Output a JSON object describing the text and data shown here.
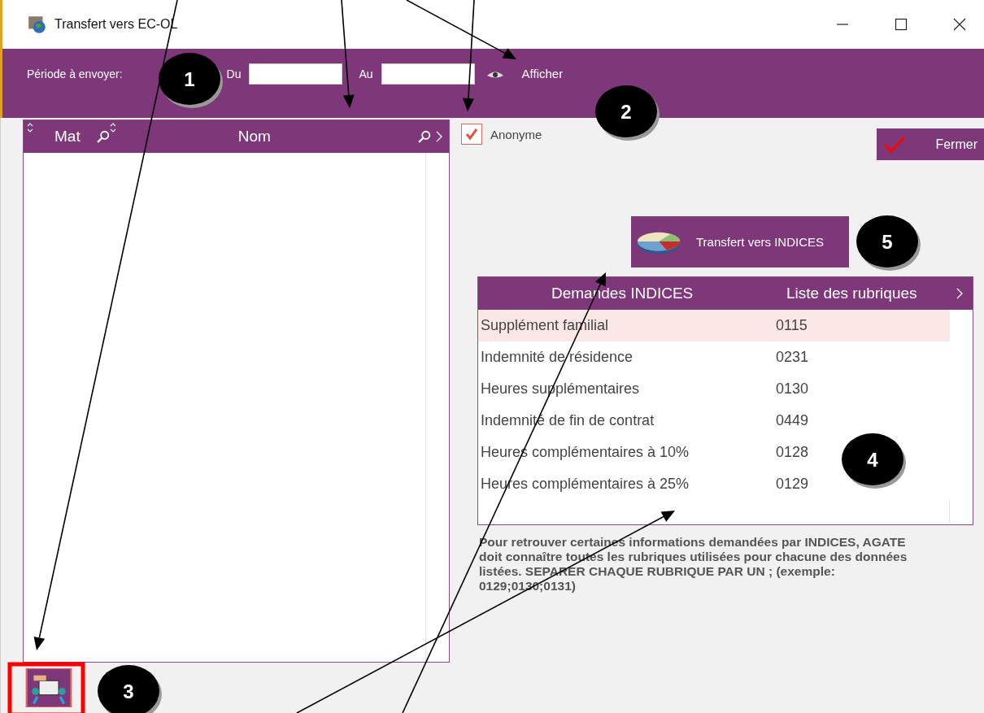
{
  "window": {
    "title": "Transfert vers EC-OL"
  },
  "toolbar": {
    "period_label": "Période à envoyer:",
    "from_label": "Du",
    "to_label": "Au",
    "show_button": "Afficher"
  },
  "employee_list": {
    "columns": [
      {
        "label": "Mat"
      },
      {
        "label": "Nom"
      }
    ]
  },
  "anonymous": {
    "label": "Anonyme",
    "checked": true
  },
  "close_button": "Fermer",
  "transfer_button": "Transfert vers INDICES",
  "indices_table": {
    "columns": [
      "Demandes INDICES",
      "Liste des rubriques"
    ],
    "rows": [
      {
        "request": "Supplément familial",
        "codes": "0115",
        "selected": true
      },
      {
        "request": "Indemnité de résidence",
        "codes": "0231",
        "selected": false
      },
      {
        "request": "Heures supplémentaires",
        "codes": "0130",
        "selected": false
      },
      {
        "request": "Indemnité de fin de contrat",
        "codes": "0449",
        "selected": false
      },
      {
        "request": "Heures complémentaires à 10%",
        "codes": "0128",
        "selected": false
      },
      {
        "request": "Heures complémentaires à 25%",
        "codes": "0129",
        "selected": false
      }
    ]
  },
  "note": "Pour retrouver certaines informations demandées par INDICES, AGATE doit connaître toutes les rubriques utilisées pour chacune des données listées. SEPARER CHAQUE RUBRIQUE PAR UN ; (exemple: 0129;0130;0131)",
  "annotations": [
    {
      "label": "1"
    },
    {
      "label": "2"
    },
    {
      "label": "3"
    },
    {
      "label": "4"
    },
    {
      "label": "5"
    }
  ]
}
